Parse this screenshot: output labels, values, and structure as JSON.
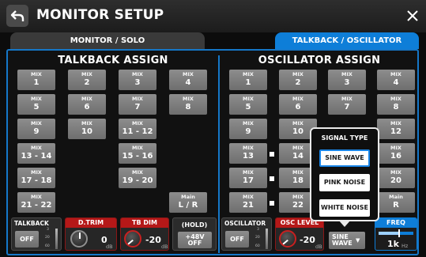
{
  "header": {
    "title": "MONITOR SETUP"
  },
  "tabs": [
    {
      "label": "MONITOR / SOLO"
    },
    {
      "label": "TALKBACK / OSCILLATOR"
    }
  ],
  "talkback_assign": {
    "title": "TALKBACK ASSIGN",
    "buttons": [
      {
        "top": "MIX",
        "name": "1"
      },
      {
        "top": "MIX",
        "name": "2"
      },
      {
        "top": "MIX",
        "name": "3"
      },
      {
        "top": "MIX",
        "name": "4"
      },
      {
        "top": "MIX",
        "name": "5"
      },
      {
        "top": "MIX",
        "name": "6"
      },
      {
        "top": "MIX",
        "name": "7"
      },
      {
        "top": "MIX",
        "name": "8"
      },
      {
        "top": "MIX",
        "name": "9"
      },
      {
        "top": "MIX",
        "name": "10"
      },
      {
        "top": "MIX",
        "name": "11 - 12"
      },
      {
        "top": "MIX",
        "name": "13 - 14"
      },
      {
        "top": "MIX",
        "name": "15 - 16"
      },
      {
        "top": "MIX",
        "name": "17 - 18"
      },
      {
        "top": "MIX",
        "name": "19 - 20"
      },
      {
        "top": "MIX",
        "name": "21 - 22"
      },
      {
        "top": "Main",
        "name": "L / R"
      }
    ]
  },
  "oscillator_assign": {
    "title": "OSCILLATOR ASSIGN",
    "buttons": [
      {
        "top": "MIX",
        "name": "1"
      },
      {
        "top": "MIX",
        "name": "2"
      },
      {
        "top": "MIX",
        "name": "3"
      },
      {
        "top": "MIX",
        "name": "4"
      },
      {
        "top": "MIX",
        "name": "5"
      },
      {
        "top": "MIX",
        "name": "6"
      },
      {
        "top": "MIX",
        "name": "7"
      },
      {
        "top": "MIX",
        "name": "8"
      },
      {
        "top": "MIX",
        "name": "9"
      },
      {
        "top": "MIX",
        "name": "10"
      },
      {
        "top": "MIX",
        "name": "12"
      },
      {
        "top": "MIX",
        "name": "13"
      },
      {
        "top": "MIX",
        "name": "14"
      },
      {
        "top": "MIX",
        "name": "16"
      },
      {
        "top": "MIX",
        "name": "17"
      },
      {
        "top": "MIX",
        "name": "18"
      },
      {
        "top": "MIX",
        "name": "20"
      },
      {
        "top": "MIX",
        "name": "21"
      },
      {
        "top": "MIX",
        "name": "22"
      },
      {
        "top": "Main",
        "name": "R"
      }
    ]
  },
  "bottom_controls": {
    "talkback": {
      "label": "TALKBACK",
      "button": "OFF",
      "scale_top": "3",
      "scale_mid": "20",
      "scale_bot": "60"
    },
    "dtrim": {
      "label": "D.TRIM",
      "value": "0",
      "unit": "dB"
    },
    "tbdim": {
      "label": "TB DIM",
      "value": "-20",
      "unit": "dB"
    },
    "phantom": {
      "label": "(HOLD)",
      "button_line1": "+48V",
      "button_line2": "OFF"
    },
    "oscillator": {
      "label": "OSCILLATOR",
      "button": "OFF",
      "scale_top": "3",
      "scale_mid": "20",
      "scale_bot": "60"
    },
    "osc_level": {
      "label": "OSC LEVEL",
      "value": "-20",
      "unit": "dB"
    },
    "signal_type_selector": {
      "line1": "SINE",
      "line2": "WAVE",
      "arrow": "▼"
    },
    "freq": {
      "label": "FREQ",
      "value": "1k",
      "unit": "Hz",
      "slider_level": 0.6
    }
  },
  "popup": {
    "title": "SIGNAL TYPE",
    "options": [
      "SINE WAVE",
      "PINK NOISE",
      "WHITE NOISE"
    ],
    "selected": "SINE WAVE"
  },
  "colors": {
    "accent_blue": "#0e7ed8",
    "red": "#b51818",
    "button_gray": "#7d7d7d"
  },
  "icons": {
    "back": "back-arrow-icon",
    "close": "close-icon"
  }
}
